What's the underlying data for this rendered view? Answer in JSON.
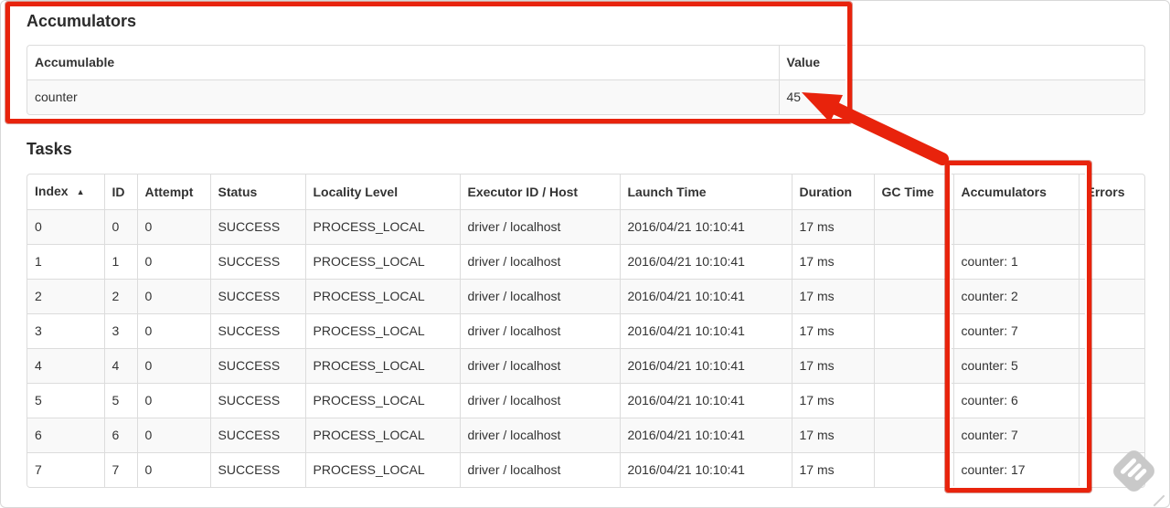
{
  "annotations": {
    "accent_color": "#e8230c",
    "watermark_color": "#c9c9c9"
  },
  "accumulators_section": {
    "title": "Accumulators",
    "table": {
      "columns": [
        "Accumulable",
        "Value"
      ],
      "rows": [
        [
          "counter",
          "45"
        ]
      ]
    }
  },
  "tasks_section": {
    "title": "Tasks",
    "sort_indicator": "▲",
    "table": {
      "columns": [
        "Index",
        "ID",
        "Attempt",
        "Status",
        "Locality Level",
        "Executor ID / Host",
        "Launch Time",
        "Duration",
        "GC Time",
        "Accumulators",
        "Errors"
      ],
      "rows": [
        [
          "0",
          "0",
          "0",
          "SUCCESS",
          "PROCESS_LOCAL",
          "driver / localhost",
          "2016/04/21 10:10:41",
          "17 ms",
          "",
          "",
          ""
        ],
        [
          "1",
          "1",
          "0",
          "SUCCESS",
          "PROCESS_LOCAL",
          "driver / localhost",
          "2016/04/21 10:10:41",
          "17 ms",
          "",
          "counter: 1",
          ""
        ],
        [
          "2",
          "2",
          "0",
          "SUCCESS",
          "PROCESS_LOCAL",
          "driver / localhost",
          "2016/04/21 10:10:41",
          "17 ms",
          "",
          "counter: 2",
          ""
        ],
        [
          "3",
          "3",
          "0",
          "SUCCESS",
          "PROCESS_LOCAL",
          "driver / localhost",
          "2016/04/21 10:10:41",
          "17 ms",
          "",
          "counter: 7",
          ""
        ],
        [
          "4",
          "4",
          "0",
          "SUCCESS",
          "PROCESS_LOCAL",
          "driver / localhost",
          "2016/04/21 10:10:41",
          "17 ms",
          "",
          "counter: 5",
          ""
        ],
        [
          "5",
          "5",
          "0",
          "SUCCESS",
          "PROCESS_LOCAL",
          "driver / localhost",
          "2016/04/21 10:10:41",
          "17 ms",
          "",
          "counter: 6",
          ""
        ],
        [
          "6",
          "6",
          "0",
          "SUCCESS",
          "PROCESS_LOCAL",
          "driver / localhost",
          "2016/04/21 10:10:41",
          "17 ms",
          "",
          "counter: 7",
          ""
        ],
        [
          "7",
          "7",
          "0",
          "SUCCESS",
          "PROCESS_LOCAL",
          "driver / localhost",
          "2016/04/21 10:10:41",
          "17 ms",
          "",
          "counter: 17",
          ""
        ]
      ]
    }
  }
}
